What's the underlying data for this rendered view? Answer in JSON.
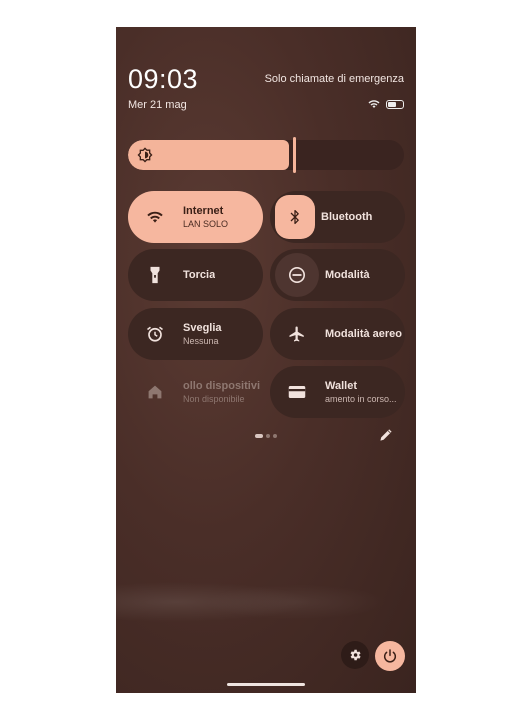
{
  "status": {
    "time": "09:03",
    "date": "Mer 21 mag",
    "carrier": "Solo chiamate di emergenza"
  },
  "brightness": {
    "level_fraction": 0.59,
    "icon": "brightness-auto-icon"
  },
  "tiles": [
    {
      "label": "Internet",
      "sub": "LAN SOLO",
      "icon": "wifi-icon",
      "state": "on"
    },
    {
      "label": "Bluetooth",
      "sub": "",
      "icon": "bluetooth-icon",
      "state": "on-icon"
    },
    {
      "label": "Torcia",
      "sub": "",
      "icon": "flashlight-icon",
      "state": "off"
    },
    {
      "label": "Modalità",
      "sub": "",
      "icon": "do-not-disturb-icon",
      "state": "off"
    },
    {
      "label": "Sveglia",
      "sub": "Nessuna",
      "icon": "alarm-icon",
      "state": "off"
    },
    {
      "label": "Modalità aereo",
      "sub": "",
      "icon": "airplane-icon",
      "state": "off"
    },
    {
      "label": "ollo dispositivi",
      "sub": "Non disponibile",
      "icon": "home-icon",
      "state": "unavailable"
    },
    {
      "label": "Wallet",
      "sub": "amento in corso...",
      "icon": "wallet-icon",
      "state": "off"
    }
  ],
  "pager": {
    "pages": 3,
    "current": 1
  },
  "colors": {
    "accent": "#f6b79f",
    "tile_bg": "#3c2722",
    "background": "#4a2e28"
  }
}
